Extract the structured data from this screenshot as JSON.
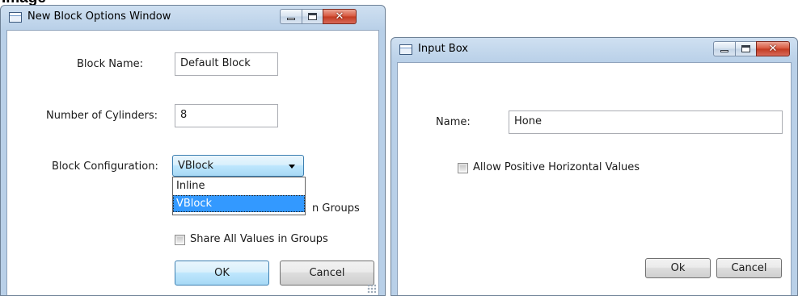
{
  "cropped_heading": "Image",
  "left_window": {
    "title": "New Block Options Window",
    "block_name_label": "Block Name:",
    "block_name_value": "Default Block",
    "cylinders_label": "Number of Cylinders:",
    "cylinders_value": "8",
    "configuration_label": "Block Configuration:",
    "configuration_value": "VBlock",
    "configuration_options": [
      "Inline",
      "VBlock"
    ],
    "hidden_checkbox_partial_text": "n Groups",
    "share_all_label": "Share All Values in Groups",
    "ok_label": "OK",
    "cancel_label": "Cancel"
  },
  "right_window": {
    "title": "Input Box",
    "name_label": "Name:",
    "name_value": "Hone",
    "allow_positive_label": "Allow Positive Horizontal Values",
    "ok_label": "Ok",
    "cancel_label": "Cancel"
  },
  "caption_buttons": {
    "close_glyph": "✕"
  },
  "colors": {
    "frame": "#b9d0e8",
    "close_button": "#c23a20",
    "selection": "#3399ff"
  }
}
